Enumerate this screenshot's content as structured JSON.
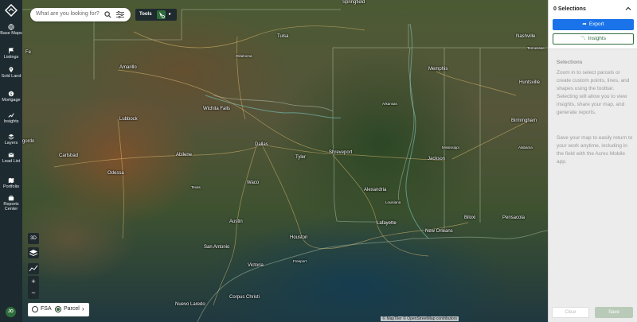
{
  "nav": {
    "items": [
      {
        "label": "Base Maps",
        "icon": "globe-icon"
      },
      {
        "label": "Listings",
        "icon": "flag-icon"
      },
      {
        "label": "Sold Land",
        "icon": "pin-icon"
      },
      {
        "label": "Mortgage",
        "icon": "dollar-icon"
      },
      {
        "label": "Insights",
        "icon": "trend-icon"
      },
      {
        "label": "Layers",
        "icon": "layers-icon"
      },
      {
        "label": "Lead List",
        "icon": "mail-icon"
      },
      {
        "label": "Portfolio",
        "icon": "map-icon"
      },
      {
        "label": "Reports Center",
        "icon": "briefcase-icon"
      }
    ],
    "avatar": "JO"
  },
  "search": {
    "placeholder": "What are you looking for?"
  },
  "tools": {
    "label": "Tools"
  },
  "map_controls": {
    "btn_3d": "3D",
    "zoom_in": "+",
    "zoom_out": "−"
  },
  "layer_toggle": {
    "fsa": "FSA",
    "parcel": "Parcel",
    "selected": "Parcel"
  },
  "attribution": "© MapTiler © OpenStreetMap contributors",
  "cities": [
    {
      "name": "Springfield",
      "small": false
    },
    {
      "name": "Tulsa",
      "small": false
    },
    {
      "name": "Nashville",
      "small": false
    },
    {
      "name": "Oklahoma",
      "small": true
    },
    {
      "name": "Tennessee",
      "small": true
    },
    {
      "name": "Amarillo",
      "small": false
    },
    {
      "name": "Memphis",
      "small": false
    },
    {
      "name": "Huntsville",
      "small": false
    },
    {
      "name": "Arkansas",
      "small": true
    },
    {
      "name": "Wichita Falls",
      "small": false
    },
    {
      "name": "Lubbock",
      "small": false
    },
    {
      "name": "Birmingham",
      "small": false
    },
    {
      "name": "Dallas",
      "small": false
    },
    {
      "name": "Shreveport",
      "small": false
    },
    {
      "name": "Mississippi",
      "small": true
    },
    {
      "name": "Alabama",
      "small": true
    },
    {
      "name": "Carlsbad",
      "small": false
    },
    {
      "name": "Abilene",
      "small": false
    },
    {
      "name": "Tyler",
      "small": false
    },
    {
      "name": "Jackson",
      "small": false
    },
    {
      "name": "Odessa",
      "small": false
    },
    {
      "name": "Waco",
      "small": false
    },
    {
      "name": "Texas",
      "small": true
    },
    {
      "name": "Alexandria",
      "small": false
    },
    {
      "name": "Louisiana",
      "small": true
    },
    {
      "name": "Biloxi",
      "small": false
    },
    {
      "name": "Pensacola",
      "small": false
    },
    {
      "name": "Austin",
      "small": false
    },
    {
      "name": "Lafayette",
      "small": false
    },
    {
      "name": "New Orleans",
      "small": false
    },
    {
      "name": "Houston",
      "small": false
    },
    {
      "name": "San Antonio",
      "small": false
    },
    {
      "name": "Freeport",
      "small": true
    },
    {
      "name": "Victoria",
      "small": false
    },
    {
      "name": "Corpus Christi",
      "small": false
    },
    {
      "name": "Nuevo Laredo",
      "small": false
    },
    {
      "name": "Fe",
      "small": false
    },
    {
      "name": "gordo",
      "small": false
    }
  ],
  "panel": {
    "title": "0 Selections",
    "export_label": "Export",
    "insights_label": "Insights",
    "section_title": "Selections",
    "paragraph1": "Zoom in to select parcels or create custom points, lines, and shapes using the toolbar. Selecting will allow you to view insights, share your map, and generate reports.",
    "paragraph2": "Save your map to easily return to your work anytime, including in the field with the Acres Mobile app.",
    "clear_label": "Clear",
    "save_label": "Save"
  },
  "colors": {
    "nav_bg": "#1d2a30",
    "brand_green": "#2f6e3c",
    "export_blue": "#1a73e8"
  }
}
